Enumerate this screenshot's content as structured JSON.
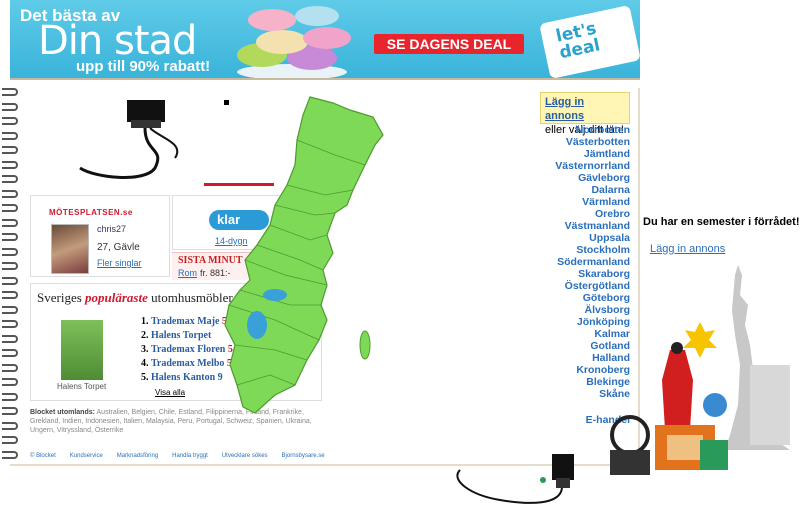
{
  "banner": {
    "line1": "Det bästa av",
    "line2": "Din stad",
    "line3": "upp till 90% rabatt!",
    "deal_button": "SE DAGENS DEAL",
    "logo_top": "let's",
    "logo_bottom": "deal"
  },
  "ads": {
    "add_link": "Lägg in annons",
    "add_sub": "eller välj ditt län!"
  },
  "counties": [
    "Norrbotten",
    "Västerbotten",
    "Jämtland",
    "Västernorrland",
    "Gävleborg",
    "Dalarna",
    "Värmland",
    "Orebro",
    "Västmanland",
    "Uppsala",
    "Stockholm",
    "Södermanland",
    "Skaraborg",
    "Östergötland",
    "Göteborg",
    "Älvsborg",
    "Jönköping",
    "Kalmar",
    "Gotland",
    "Halland",
    "Kronoberg",
    "Blekinge",
    "Skåne"
  ],
  "ehandel": "E-handel",
  "motesplatsen": {
    "logo": "MÖTESPLATSEN.se",
    "name": "chris27",
    "age": "27, Gävle",
    "more": "Fler singlar"
  },
  "klar": {
    "logo": "klar",
    "sub": "14-dygn"
  },
  "sista": {
    "title": "SISTA MINUT",
    "city": "Rom",
    "price": "fr. 881:-"
  },
  "popular": {
    "title_pre": "Sveriges ",
    "title_em": "populäraste",
    "title_post": " utomhusmöbler",
    "image_caption": "Halens Torpet",
    "items": [
      {
        "n": "1.",
        "name": "Trademax Maje",
        "price": "5:-"
      },
      {
        "n": "2.",
        "name": "Halens Torpet",
        "price": ""
      },
      {
        "n": "3.",
        "name": "Trademax Floren",
        "price": "5:-"
      },
      {
        "n": "4.",
        "name": "Trademax Melbo",
        "price": "5:-"
      },
      {
        "n": "5.",
        "name": "Halens Kanton 9",
        "price": ""
      }
    ],
    "visa_alla": "Visa alla"
  },
  "utomlands": {
    "label": "Blocket utomlands:",
    "text": "Australien, Belgien, Chile, Estland, Filippinerna, Finland, Frankrike, Grekland, Indien, Indonesien, Italien, Malaysia, Peru, Portugal, Schweiz, Spanien, Ukraina, Ungern, Vitryssland, Österrike"
  },
  "footer": [
    "© Blocket",
    "Kundservice",
    "Marknadsföring",
    "Handla tryggt",
    "Utvecklare sökes",
    "Bjornsbysare.se"
  ],
  "semester": {
    "title": "Du har en semester i förrådet!",
    "link": "Lägg in annons"
  },
  "colors": {
    "banner_bg": "#3ab3da",
    "deal_red": "#e8252c",
    "link_blue": "#2a6fba",
    "map_green": "#7ed957"
  }
}
